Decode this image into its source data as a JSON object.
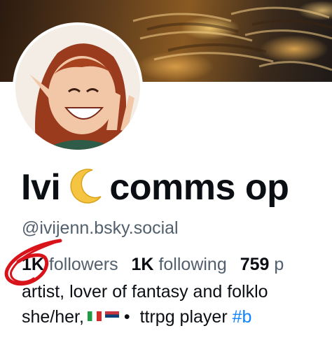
{
  "profile": {
    "display_name_before": "Ivi",
    "display_name_after": "comms op",
    "handle": "@ivijenn.bsky.social",
    "followers_count": "1K",
    "followers_label": "followers",
    "following_count": "1K",
    "following_label": "following",
    "posts_count": "759",
    "posts_label": "p",
    "bio_line1": "artist, lover of fantasy and folklo",
    "bio_line2_before": "she/her,",
    "bio_line2_bullet": "•",
    "bio_line2_after": "ttrpg player",
    "bio_hashtag": "#b"
  },
  "icons": {
    "moon": "crescent-moon-emoji",
    "flag1": "italy-flag",
    "flag2": "serbia-flag"
  },
  "colors": {
    "link": "#1083fe",
    "muted": "#52606d",
    "annotation": "#d8141a"
  }
}
